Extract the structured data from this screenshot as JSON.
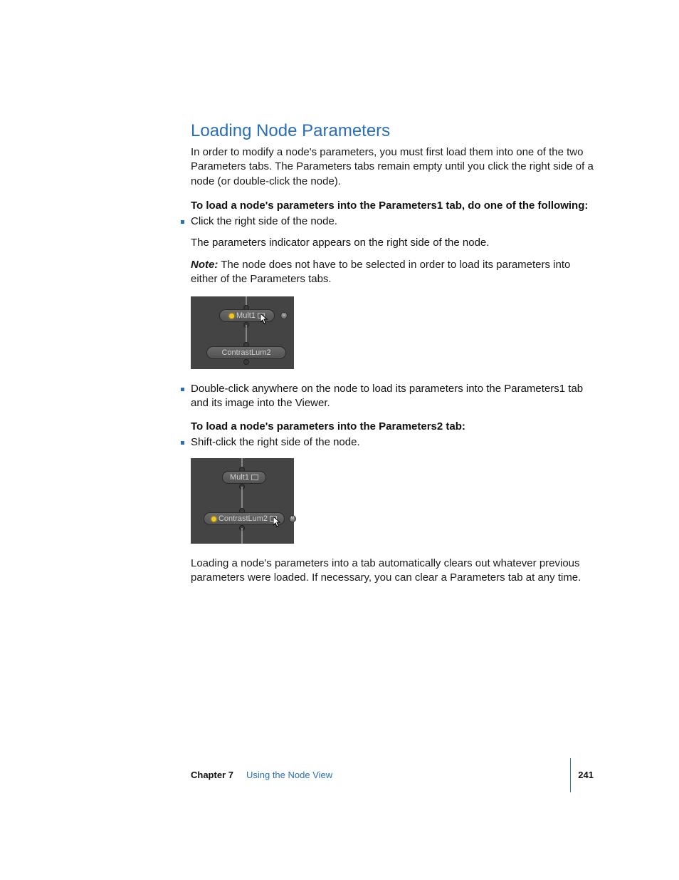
{
  "heading": "Loading Node Parameters",
  "intro": "In order to modify a node's parameters, you must first load them into one of the two Parameters tabs. The Parameters tabs remain empty until you click the right side of a node (or double-click the node).",
  "sub1": "To load a node's parameters into the Parameters1 tab, do one of the following:",
  "b1_item": "Click the right side of the node.",
  "b1_follow": "The parameters indicator appears on the right side of the node.",
  "note_label": "Note:",
  "note_text": "  The node does not have to be selected in order to load its parameters into either of the Parameters tabs.",
  "fig1": {
    "node_top": "Mult1",
    "node_bottom": "ContrastLum2",
    "m": "M"
  },
  "b2_item": "Double-click anywhere on the node to load its parameters into the Parameters1 tab and its image into the Viewer.",
  "sub2": "To load a node's parameters into the Parameters2 tab:",
  "b3_item": "Shift-click the right side of the node.",
  "fig2": {
    "node_top": "Mult1",
    "node_bottom": "ContrastLum2",
    "m": "M"
  },
  "closing": "Loading a node's parameters into a tab automatically clears out whatever previous parameters were loaded. If necessary, you can clear a Parameters tab at any time.",
  "footer": {
    "chapter": "Chapter 7",
    "title": "Using the Node View",
    "page": "241"
  }
}
